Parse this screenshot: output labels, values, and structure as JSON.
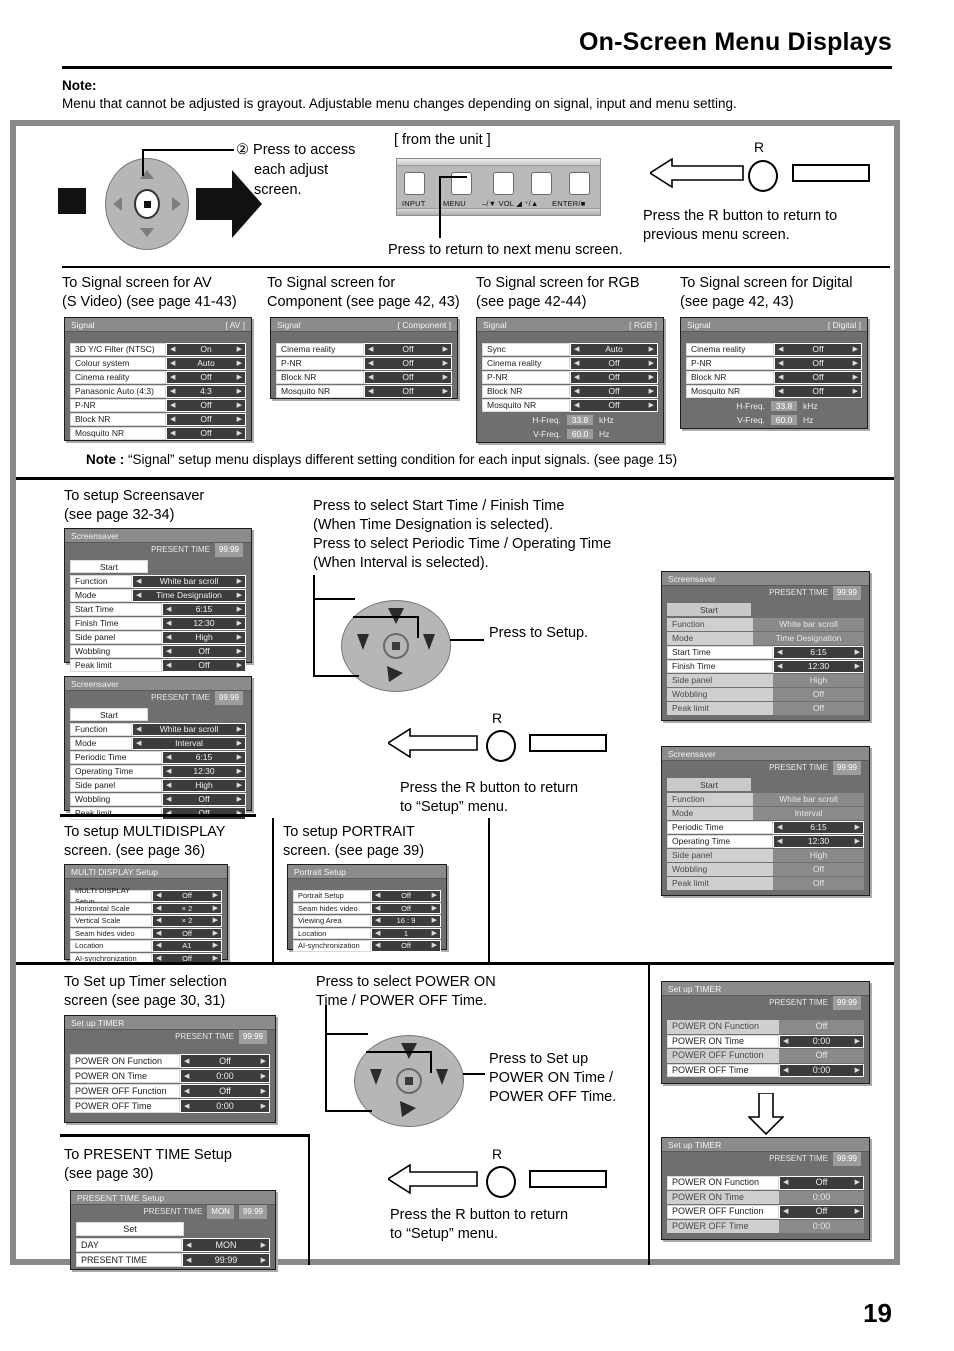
{
  "header": {
    "title": "On-Screen Menu Displays",
    "note_label": "Note:",
    "note_text": "Menu that cannot be adjusted is grayout. Adjustable menu changes depending on signal, input and menu setting."
  },
  "page_number": "19",
  "top_panel": {
    "step_text_line1": "② Press to access",
    "step_text_line2": "each adjust",
    "step_text_line3": "screen.",
    "from_unit_label": "[ from the unit ]",
    "unit_buttons": [
      "INPUT",
      "MENU",
      "–/▼ VOL ◢ ⁺/▲",
      "ENTER/■"
    ],
    "unit_caption": "Press to return to next menu screen.",
    "r_label": "R",
    "r_caption_line1": "Press the R button to return to",
    "r_caption_line2": "previous menu screen."
  },
  "signal_section": {
    "captions": [
      {
        "line1": "To Signal screen for AV",
        "line2": "(S Video) (see page 41-43)"
      },
      {
        "line1": "To Signal screen for",
        "line2": "Component (see page 42, 43)"
      },
      {
        "line1": "To Signal screen for RGB",
        "line2": "(see page 42-44)"
      },
      {
        "line1": "To Signal screen for Digital",
        "line2": "(see page 42, 43)"
      }
    ],
    "note_label": "Note :",
    "note_text": "“Signal” setup menu displays different setting condition for each input signals. (see page 15)",
    "menus": [
      {
        "title": "Signal",
        "input": "[ AV ]",
        "rows": [
          {
            "name": "3D Y/C Filter (NTSC)",
            "value": "On"
          },
          {
            "name": "Colour system",
            "value": "Auto"
          },
          {
            "name": "Cinema reality",
            "value": "Off"
          },
          {
            "name": "Panasonic Auto (4:3)",
            "value": "4:3"
          },
          {
            "name": "P-NR",
            "value": "Off"
          },
          {
            "name": "Block NR",
            "value": "Off"
          },
          {
            "name": "Mosquito NR",
            "value": "Off"
          }
        ],
        "freq": []
      },
      {
        "title": "Signal",
        "input": "[ Component ]",
        "rows": [
          {
            "name": "Cinema reality",
            "value": "Off"
          },
          {
            "name": "P-NR",
            "value": "Off"
          },
          {
            "name": "Block NR",
            "value": "Off"
          },
          {
            "name": "Mosquito NR",
            "value": "Off"
          }
        ],
        "freq": []
      },
      {
        "title": "Signal",
        "input": "[ RGB ]",
        "rows": [
          {
            "name": "Sync",
            "value": "Auto"
          },
          {
            "name": "Cinema reality",
            "value": "Off"
          },
          {
            "name": "P-NR",
            "value": "Off"
          },
          {
            "name": "Block NR",
            "value": "Off"
          },
          {
            "name": "Mosquito NR",
            "value": "Off"
          }
        ],
        "freq": [
          {
            "label": "H-Freq.",
            "value": "33.8",
            "unit": "kHz"
          },
          {
            "label": "V-Freq.",
            "value": "60.0",
            "unit": "Hz"
          }
        ]
      },
      {
        "title": "Signal",
        "input": "[ Digital ]",
        "rows": [
          {
            "name": "Cinema reality",
            "value": "Off"
          },
          {
            "name": "P-NR",
            "value": "Off"
          },
          {
            "name": "Block NR",
            "value": "Off"
          },
          {
            "name": "Mosquito NR",
            "value": "Off"
          }
        ],
        "freq": [
          {
            "label": "H-Freq.",
            "value": "33.8",
            "unit": "kHz"
          },
          {
            "label": "V-Freq.",
            "value": "60.0",
            "unit": "Hz"
          }
        ]
      }
    ]
  },
  "screensaver_section": {
    "caption_line1": "To setup  Screensaver",
    "caption_line2": "(see page 32-34)",
    "instruction_line1": "Press to select Start Time / Finish Time",
    "instruction_line2": "(When Time Designation is selected).",
    "instruction_line3": "Press to select Periodic Time / Operating Time",
    "instruction_line4": "(When Interval is selected).",
    "press_setup": "Press to Setup.",
    "r_label": "R",
    "r_caption_line1": "Press the R button to return",
    "r_caption_line2": "to “Setup” menu.",
    "menu_time_designation": {
      "title": "Screensaver",
      "present_label": "PRESENT  TIME",
      "present_value": "99:99",
      "start_button": "Start",
      "rows": [
        {
          "name": "Function",
          "value": "White bar scroll"
        },
        {
          "name": "Mode",
          "value": "Time Designation"
        },
        {
          "name": "Start Time",
          "value": "6:15"
        },
        {
          "name": "Finish Time",
          "value": "12:30"
        },
        {
          "name": "Side panel",
          "value": "High"
        },
        {
          "name": "Wobbling",
          "value": "Off"
        },
        {
          "name": "Peak limit",
          "value": "Off"
        }
      ]
    },
    "menu_interval": {
      "title": "Screensaver",
      "present_label": "PRESENT  TIME",
      "present_value": "99:99",
      "start_button": "Start",
      "rows": [
        {
          "name": "Function",
          "value": "White bar scroll"
        },
        {
          "name": "Mode",
          "value": "Interval"
        },
        {
          "name": "Periodic Time",
          "value": "6:15"
        },
        {
          "name": "Operating Time",
          "value": "12:30"
        },
        {
          "name": "Side panel",
          "value": "High"
        },
        {
          "name": "Wobbling",
          "value": "Off"
        },
        {
          "name": "Peak limit",
          "value": "Off"
        }
      ]
    },
    "menu_time_designation_focused": {
      "title": "Screensaver",
      "present_label": "PRESENT  TIME",
      "present_value": "99:99",
      "start_button": "Start",
      "rows": [
        {
          "name": "Function",
          "value": "White bar scroll",
          "dim": true
        },
        {
          "name": "Mode",
          "value": "Time Designation",
          "dim": true
        },
        {
          "name": "Start Time",
          "value": "6:15",
          "dim": false
        },
        {
          "name": "Finish Time",
          "value": "12:30",
          "dim": false
        },
        {
          "name": "Side panel",
          "value": "High",
          "dim": true
        },
        {
          "name": "Wobbling",
          "value": "Off",
          "dim": true
        },
        {
          "name": "Peak limit",
          "value": "Off",
          "dim": true
        }
      ]
    },
    "menu_interval_focused": {
      "title": "Screensaver",
      "present_label": "PRESENT  TIME",
      "present_value": "99:99",
      "start_button": "Start",
      "rows": [
        {
          "name": "Function",
          "value": "White bar scroll",
          "dim": true
        },
        {
          "name": "Mode",
          "value": "Interval",
          "dim": true
        },
        {
          "name": "Periodic Time",
          "value": "6:15",
          "dim": false
        },
        {
          "name": "Operating Time",
          "value": "12:30",
          "dim": false
        },
        {
          "name": "Side panel",
          "value": "High",
          "dim": true
        },
        {
          "name": "Wobbling",
          "value": "Off",
          "dim": true
        },
        {
          "name": "Peak limit",
          "value": "Off",
          "dim": true
        }
      ]
    }
  },
  "multidisplay_section": {
    "caption_line1": "To setup MULTIDISPLAY",
    "caption_line2": "screen. (see page 36)",
    "menu": {
      "title": "MULTI DISPLAY Setup",
      "rows": [
        {
          "name": "MULTI DISPLAY Setup",
          "value": "Off"
        },
        {
          "name": "Horizontal Scale",
          "value": "× 2"
        },
        {
          "name": "Vertical Scale",
          "value": "× 2"
        },
        {
          "name": "Seam hides video",
          "value": "Off"
        },
        {
          "name": "Location",
          "value": "A1"
        },
        {
          "name": "AI-synchronization",
          "value": "Off"
        }
      ]
    }
  },
  "portrait_section": {
    "caption_line1": "To setup PORTRAIT",
    "caption_line2": "screen. (see page 39)",
    "menu": {
      "title": "Portrait Setup",
      "rows": [
        {
          "name": "Portrait Setup",
          "value": "Off"
        },
        {
          "name": "Seam hides video",
          "value": "Off"
        },
        {
          "name": "Viewing Area",
          "value": "16 : 9"
        },
        {
          "name": "Location",
          "value": "1"
        },
        {
          "name": "AI-synchronization",
          "value": "Off"
        }
      ]
    }
  },
  "timer_section": {
    "caption_line1": "To Set up  Timer  selection",
    "caption_line2": "screen (see page 30, 31)",
    "instruction_line1": "Press to select POWER ON",
    "instruction_line2": "Time / POWER OFF Time.",
    "press_setup_line1": "Press to Set up",
    "press_setup_line2": "POWER ON Time /",
    "press_setup_line3": "POWER OFF Time.",
    "r_label": "R",
    "r_caption_line1": "Press the R button to return",
    "r_caption_line2": "to “Setup” menu.",
    "menu": {
      "title": "Set up TIMER",
      "present_label": "PRESENT  TIME",
      "present_value": "99:99",
      "rows": [
        {
          "name": "POWER ON Function",
          "value": "Off"
        },
        {
          "name": "POWER ON Time",
          "value": "0:00"
        },
        {
          "name": "POWER OFF Function",
          "value": "Off"
        },
        {
          "name": "POWER OFF Time",
          "value": "0:00"
        }
      ]
    },
    "menu_time_focused": {
      "title": "Set up TIMER",
      "present_label": "PRESENT  TIME",
      "present_value": "99:99",
      "rows": [
        {
          "name": "POWER ON Function",
          "value": "Off",
          "dim": true
        },
        {
          "name": "POWER ON Time",
          "value": "0:00",
          "dim": false
        },
        {
          "name": "POWER OFF Function",
          "value": "Off",
          "dim": true
        },
        {
          "name": "POWER OFF Time",
          "value": "0:00",
          "dim": false
        }
      ]
    },
    "menu_function_focused": {
      "title": "Set up TIMER",
      "present_label": "PRESENT  TIME",
      "present_value": "99:99",
      "rows": [
        {
          "name": "POWER ON Function",
          "value": "Off",
          "dim": false
        },
        {
          "name": "POWER ON Time",
          "value": "0:00",
          "dim": true
        },
        {
          "name": "POWER OFF Function",
          "value": "Off",
          "dim": false
        },
        {
          "name": "POWER OFF Time",
          "value": "0:00",
          "dim": true
        }
      ]
    }
  },
  "present_time_section": {
    "caption_line1": "To PRESENT  TIME Setup",
    "caption_line2": "(see page 30)",
    "menu": {
      "title": "PRESENT  TIME Setup",
      "present_label": "PRESENT  TIME",
      "present_day": "MON",
      "present_value": "99:99",
      "set_button": "Set",
      "rows": [
        {
          "name": "DAY",
          "value": "MON"
        },
        {
          "name": "PRESENT  TIME",
          "value": "99:99"
        }
      ]
    }
  }
}
